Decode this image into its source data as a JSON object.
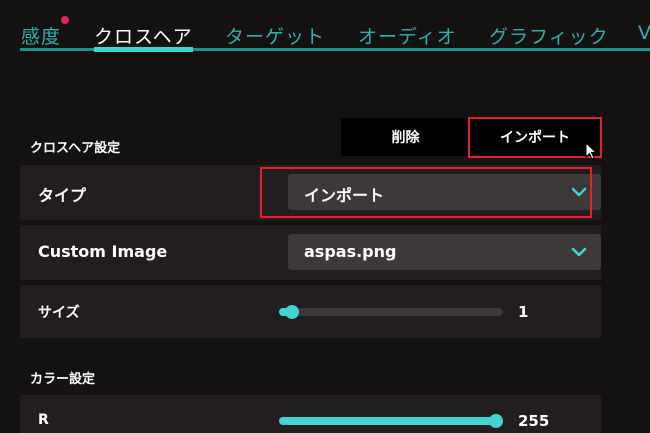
{
  "tabs": [
    {
      "label": "感度",
      "active": false,
      "has_notification": true
    },
    {
      "label": "クロスヘア",
      "active": true
    },
    {
      "label": "ターゲット",
      "active": false
    },
    {
      "label": "オーディオ",
      "active": false
    },
    {
      "label": "グラフィック",
      "active": false
    },
    {
      "label": "V",
      "active": false
    }
  ],
  "crosshair_section": {
    "title": "クロスヘア設定",
    "delete_label": "削除",
    "import_label": "インポート"
  },
  "type_row": {
    "label": "タイプ",
    "value": "インポート"
  },
  "custom_image_row": {
    "label": "Custom Image",
    "value": "aspas.png"
  },
  "size_row": {
    "label": "サイズ",
    "value": "1",
    "fill_fraction": 0.03
  },
  "color_section": {
    "title": "カラー設定"
  },
  "r_row": {
    "label": "R",
    "value": "255",
    "fill_fraction": 1.0
  },
  "colors": {
    "accent": "#3fd4d2",
    "highlight": "#e8202a",
    "notification": "#e0265a"
  }
}
